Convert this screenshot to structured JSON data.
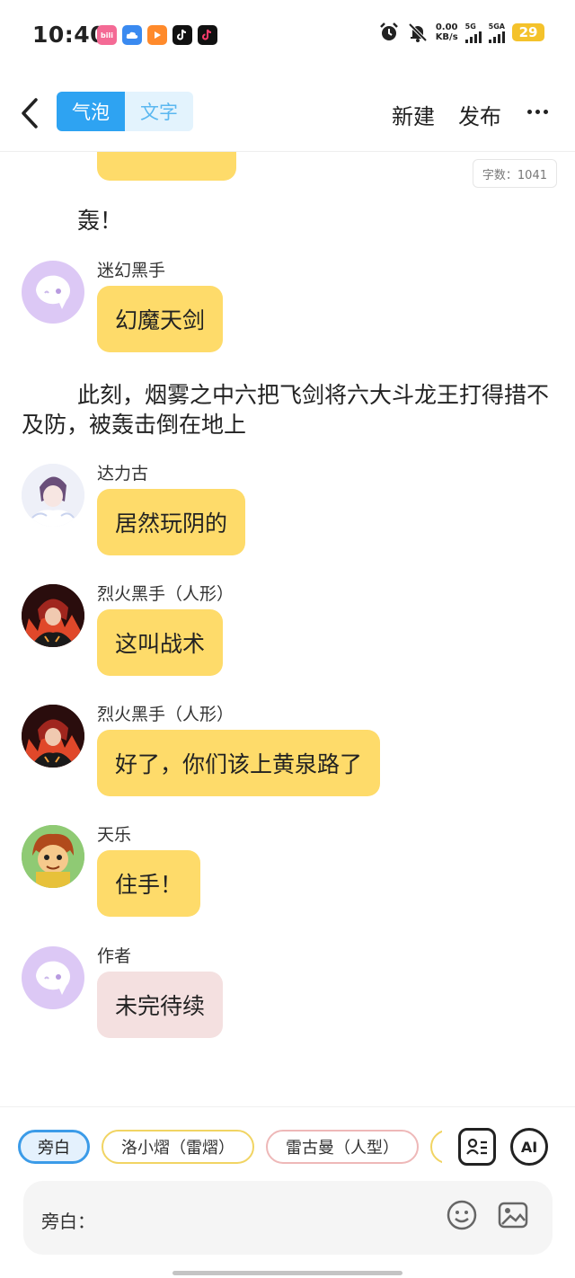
{
  "status_bar": {
    "time": "10:40",
    "apps": [
      {
        "icon": "bilibili-icon",
        "label": "bili",
        "color": "#f46a95"
      },
      {
        "icon": "cloud-app-icon",
        "label": "",
        "color": "#3a8af0"
      },
      {
        "icon": "video-app-icon",
        "label": "",
        "color": "#ff8a2b"
      },
      {
        "icon": "douyin-icon",
        "label": "",
        "color": "#111111"
      },
      {
        "icon": "tiktok-icon",
        "label": "",
        "color": "#111111"
      }
    ],
    "net_speed_value": "0.00",
    "net_speed_unit": "KB/s",
    "signal_1_label": "5G",
    "signal_2_label": "5GA",
    "battery": "29"
  },
  "nav": {
    "tab_bubble": "气泡",
    "tab_text": "文字",
    "new_label": "新建",
    "publish_label": "发布"
  },
  "chat": {
    "word_count": "字数：1041",
    "narrations": [
      "轰！",
      "此刻，烟雾之中六把飞剑将六大斗龙王打得措不及防，被轰击倒在地上"
    ],
    "messages": [
      {
        "sender": "迷幻黑手",
        "text": "幻魔天剑",
        "avatar": "ghost"
      },
      {
        "sender": "达力古",
        "text": "居然玩阴的",
        "avatar": "character-white"
      },
      {
        "sender": "烈火黑手（人形）",
        "text": "这叫战术",
        "avatar": "character-fire"
      },
      {
        "sender": "烈火黑手（人形）",
        "text": "好了，你们该上黄泉路了",
        "avatar": "character-fire"
      },
      {
        "sender": "天乐",
        "text": "住手！",
        "avatar": "character-cartoon"
      },
      {
        "sender": "作者",
        "text": "未完待续",
        "avatar": "ghost"
      }
    ]
  },
  "bottom": {
    "chips": [
      "旁白",
      "洛小熠（雷熠）",
      "雷古曼（人型）"
    ],
    "ai_label": "AI",
    "input_label": "旁白："
  },
  "colors": {
    "accent": "#2ea3f2",
    "bubble_yellow": "#fedb6a",
    "bubble_pink": "#f4e0e0",
    "ghost_avatar_bg": "#dcc8f5"
  }
}
